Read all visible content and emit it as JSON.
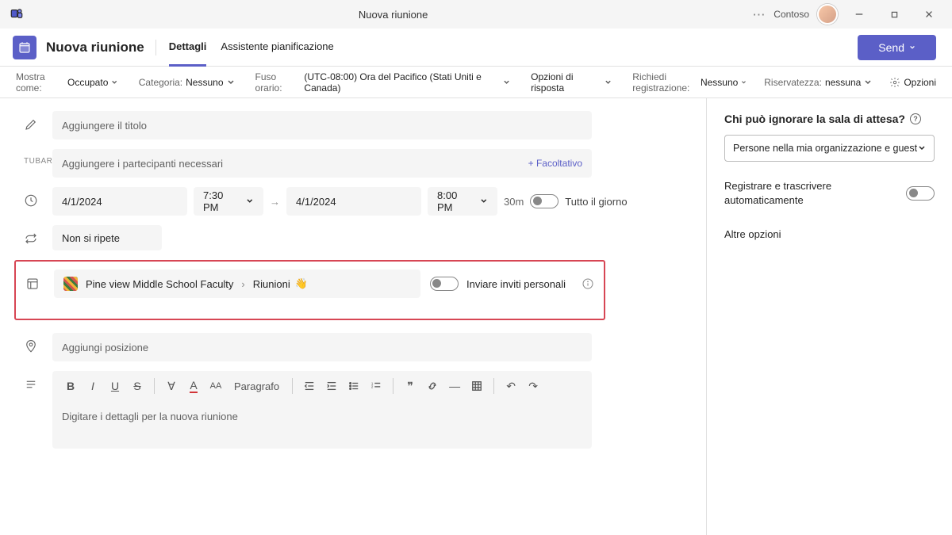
{
  "titlebar": {
    "title": "Nuova riunione",
    "org": "Contoso"
  },
  "header": {
    "page_title": "Nuova riunione",
    "tabs": {
      "details": "Dettagli",
      "scheduling": "Assistente pianificazione"
    },
    "send": "Send"
  },
  "optbar": {
    "show_as_label": "Mostra come:",
    "show_as_value": "Occupato",
    "category_label": "Categoria:",
    "category_value": "Nessuno",
    "timezone_label": "Fuso orario:",
    "timezone_value": "(UTC-08:00) Ora del Pacifico (Stati Uniti e Canada)",
    "response_options": "Opzioni di risposta",
    "require_reg_label": "Richiedi registrazione:",
    "require_reg_value": "Nessuno",
    "sensitivity_label": "Riservatezza:",
    "sensitivity_value": "nessuna",
    "options": "Opzioni"
  },
  "form": {
    "title_placeholder": "Aggiungere il titolo",
    "attendees_label": "TUBARE",
    "attendees_placeholder": "Aggiungere i partecipanti necessari",
    "optional": "+ Facoltativo",
    "date_start": "4/1/2024",
    "time_start": "7:30 PM",
    "date_end": "4/1/2024",
    "time_end": "8:00 PM",
    "duration": "30m",
    "all_day": "Tutto il giorno",
    "recurrence": "Non si ripete",
    "channel_team": "Pine view Middle School Faculty",
    "channel_name": "Riunioni",
    "send_personal_invites": "Inviare inviti personali",
    "location_placeholder": "Aggiungi posizione",
    "paragraph": "Paragrafo",
    "editor_placeholder": "Digitare i dettagli per la nuova riunione"
  },
  "side": {
    "lobby_title": "Chi può ignorare la sala di attesa?",
    "lobby_value": "Persone nella mia organizzazione e guest",
    "record_label": "Registrare e trascrivere automaticamente",
    "more": "Altre opzioni"
  }
}
